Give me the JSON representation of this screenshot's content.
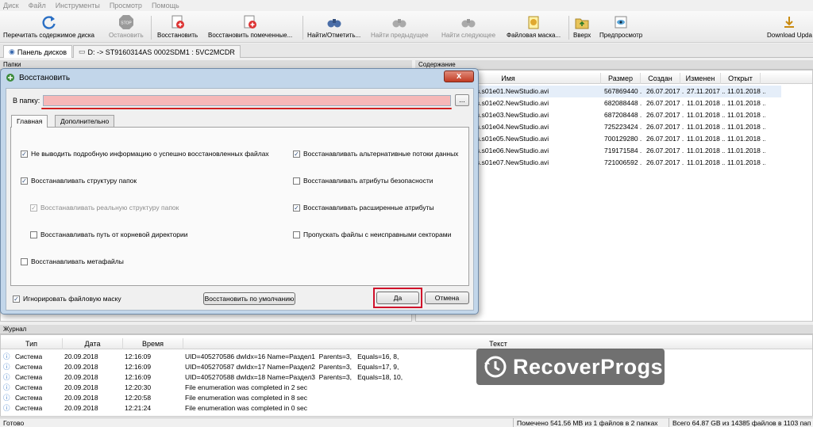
{
  "menu": [
    "Диск",
    "Файл",
    "Инструменты",
    "Просмотр",
    "Помощь"
  ],
  "toolbar": {
    "reread": "Перечитать содержимое диска",
    "stop": "Остановить",
    "restore": "Восстановить",
    "restore_marked": "Восстановить помеченные...",
    "find": "Найти/Отметить...",
    "find_prev": "Найти предыдущее",
    "find_next": "Найти следующее",
    "file_mask": "Файловая маска...",
    "up": "Вверх",
    "preview": "Предпросмотр",
    "download": "Download Upda"
  },
  "tabs": {
    "disk_panel": "Панель дисков",
    "drive": "D: -> ST9160314AS 0002SDM1 : 5VC2MCDR"
  },
  "folders_header": "Папки",
  "contents": {
    "header": "Содержание",
    "columns": [
      "Имя",
      "Размер",
      "Создан",
      "Изменен",
      "Открыт"
    ],
    "rows": [
      {
        "name": "s.s01e01.NewStudio.avi",
        "size": "567869440 ...",
        "created": "26.07.2017 ...",
        "modified": "27.11.2017 ...",
        "opened": "11.01.2018 ..."
      },
      {
        "name": "s.s01e02.NewStudio.avi",
        "size": "682088448 ...",
        "created": "26.07.2017 ...",
        "modified": "11.01.2018 ...",
        "opened": "11.01.2018 ..."
      },
      {
        "name": "s.s01e03.NewStudio.avi",
        "size": "687208448 ...",
        "created": "26.07.2017 ...",
        "modified": "11.01.2018 ...",
        "opened": "11.01.2018 ..."
      },
      {
        "name": "s.s01e04.NewStudio.avi",
        "size": "725223424 ...",
        "created": "26.07.2017 ...",
        "modified": "11.01.2018 ...",
        "opened": "11.01.2018 ..."
      },
      {
        "name": "s.s01e05.NewStudio.avi",
        "size": "700129280 ...",
        "created": "26.07.2017 ...",
        "modified": "11.01.2018 ...",
        "opened": "11.01.2018 ..."
      },
      {
        "name": "s.s01e06.NewStudio.avi",
        "size": "719171584 ...",
        "created": "26.07.2017 ...",
        "modified": "11.01.2018 ...",
        "opened": "11.01.2018 ..."
      },
      {
        "name": "s.s01e07.NewStudio.avi",
        "size": "721006592 ...",
        "created": "26.07.2017 ...",
        "modified": "11.01.2018 ...",
        "opened": "11.01.2018 ..."
      }
    ]
  },
  "log": {
    "header": "Журнал",
    "columns": [
      "Тип",
      "Дата",
      "Время",
      "Текст"
    ],
    "rows": [
      {
        "type": "Система",
        "date": "20.09.2018",
        "time": "12:16:09",
        "text": "UID=405270586 dwIdx=16 Name=Раздел1  Parents=3,   Equals=16, 8,"
      },
      {
        "type": "Система",
        "date": "20.09.2018",
        "time": "12:16:09",
        "text": "UID=405270587 dwIdx=17 Name=Раздел2  Parents=3,   Equals=17, 9,"
      },
      {
        "type": "Система",
        "date": "20.09.2018",
        "time": "12:16:09",
        "text": "UID=405270588 dwIdx=18 Name=Раздел3  Parents=3,   Equals=18, 10,"
      },
      {
        "type": "Система",
        "date": "20.09.2018",
        "time": "12:20:30",
        "text": "File enumeration was completed in 2 sec"
      },
      {
        "type": "Система",
        "date": "20.09.2018",
        "time": "12:20:58",
        "text": "File enumeration was completed in 8 sec"
      },
      {
        "type": "Система",
        "date": "20.09.2018",
        "time": "12:21:24",
        "text": "File enumeration was completed in 0 sec"
      }
    ]
  },
  "status": {
    "ready": "Готово",
    "marked": "Помечено 541.56 MB из 1 файлов в 2 папках",
    "total": "Всего 64.87 GB из 14385 файлов в 1103 пап"
  },
  "watermark": "RecoverProgs",
  "dialog": {
    "title": "Восстановить",
    "close": "x",
    "folder_label": "В папку:",
    "folder_value": "",
    "browse": "...",
    "tab_main": "Главная",
    "tab_extra": "Дополнительно",
    "options": {
      "no_verbose": {
        "label": "Не выводить подробную информацию о успешно восстановленных файлах",
        "checked": true
      },
      "restore_structure": {
        "label": "Восстанавливать структуру папок",
        "checked": true
      },
      "restore_real_structure": {
        "label": "Восстанавливать реальную структуру папок",
        "checked": true,
        "disabled": true
      },
      "restore_root_path": {
        "label": "Восстанавливать путь от корневой директории",
        "checked": false
      },
      "restore_metafiles": {
        "label": "Восстанавливать метафайлы",
        "checked": false
      },
      "alt_streams": {
        "label": "Восстанавливать альтернативные потоки данных",
        "checked": true
      },
      "security_attrs": {
        "label": "Восстанавливать атрибуты безопасности",
        "checked": false
      },
      "extended_attrs": {
        "label": "Восстанавливать расширенные атрибуты",
        "checked": true
      },
      "skip_bad": {
        "label": "Пропускать файлы с неисправными секторами",
        "checked": false
      },
      "ignore_mask": {
        "label": "Игнорировать файловую маску",
        "checked": true
      }
    },
    "defaults_button": "Восстановить по умолчанию",
    "ok_button": "Да",
    "cancel_button": "Отмена"
  },
  "colors": {
    "highlight": "#d0102a",
    "path_field": "#f6b8b8",
    "dialog_frame": "#c2d6ea"
  }
}
